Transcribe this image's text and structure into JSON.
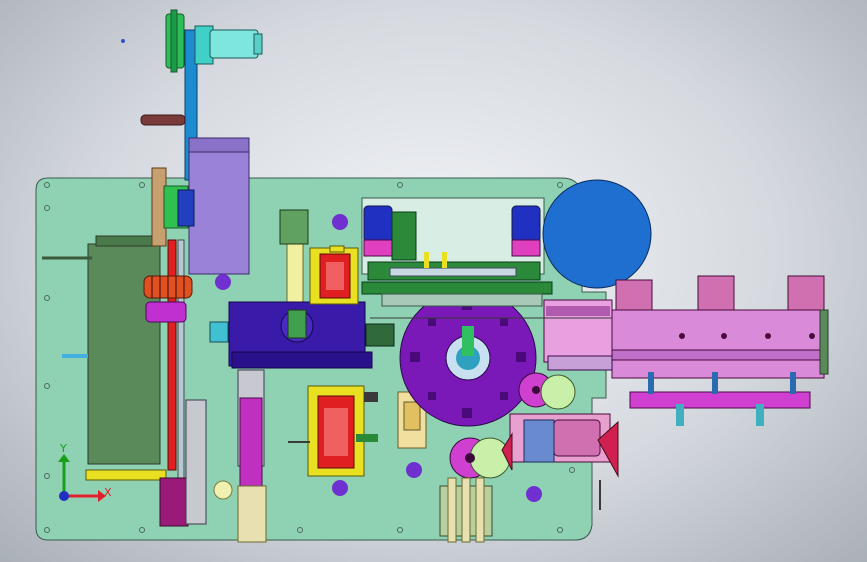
{
  "viewport": {
    "background_center": "#f2f4f7",
    "background_edge": "#aab0b8"
  },
  "triad": {
    "x_label": "X",
    "y_label": "Y",
    "x_color": "#e0202a",
    "y_color": "#18a018",
    "z_color": "#2030c0"
  },
  "colors": {
    "base_plate": "#8fd1b3",
    "motor_box": "#9a82d8",
    "blue_disc": "#1e6fd0",
    "purple_dial": "#7a18b8",
    "conveyor": "#d98ad9",
    "magenta": "#d020b0",
    "yellow": "#e8e020",
    "red": "#e02020",
    "dark_green": "#5a8a5a",
    "indigo_block": "#3a1aa8"
  }
}
